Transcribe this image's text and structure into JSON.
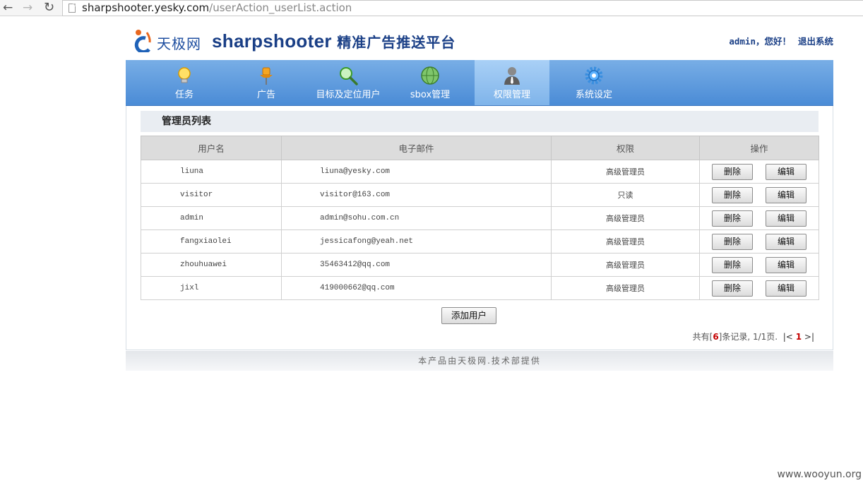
{
  "browser": {
    "url_domain": "sharpshooter.yesky.com",
    "url_path": "/userAction_userList.action"
  },
  "header": {
    "logo_text": "天极网",
    "brand_name": "sharpshooter",
    "brand_subtitle": "精准广告推送平台",
    "welcome": "admin，您好！",
    "logout": "退出系统"
  },
  "nav": {
    "items": [
      {
        "label": "任务",
        "icon": "lightbulb-icon"
      },
      {
        "label": "广告",
        "icon": "pushpin-icon"
      },
      {
        "label": "目标及定位用户",
        "icon": "magnifier-icon"
      },
      {
        "label": "sbox管理",
        "icon": "globe-icon"
      },
      {
        "label": "权限管理",
        "icon": "user-admin-icon",
        "active": true
      },
      {
        "label": "系统设定",
        "icon": "gear-icon"
      }
    ]
  },
  "main": {
    "section_title": "管理员列表",
    "columns": [
      "用户名",
      "电子邮件",
      "权限",
      "操作"
    ],
    "rows": [
      {
        "username": "liuna",
        "email": "liuna@yesky.com",
        "permission": "高级管理员"
      },
      {
        "username": "visitor",
        "email": "visitor@163.com",
        "permission": "只读"
      },
      {
        "username": "admin",
        "email": "admin@sohu.com.cn",
        "permission": "高级管理员"
      },
      {
        "username": "fangxiaolei",
        "email": "jessicafong@yeah.net",
        "permission": "高级管理员"
      },
      {
        "username": "zhouhuawei",
        "email": "35463412@qq.com",
        "permission": "高级管理员"
      },
      {
        "username": "jixl",
        "email": "419000662@qq.com",
        "permission": "高级管理员"
      }
    ],
    "delete_label": "删除",
    "edit_label": "编辑",
    "add_user_label": "添加用户",
    "pager": {
      "prefix": "共有[",
      "count": "6",
      "suffix": "]条记录, 1/1页.",
      "prev": "|<",
      "current": "1",
      "next": ">|"
    }
  },
  "footer": {
    "text": "本产品由天极网.技术部提供"
  },
  "watermark": "www.wooyun.org",
  "colors": {
    "nav_bg": "#4a8bd6",
    "brand": "#1a3f86",
    "accent_red": "#c40000"
  }
}
